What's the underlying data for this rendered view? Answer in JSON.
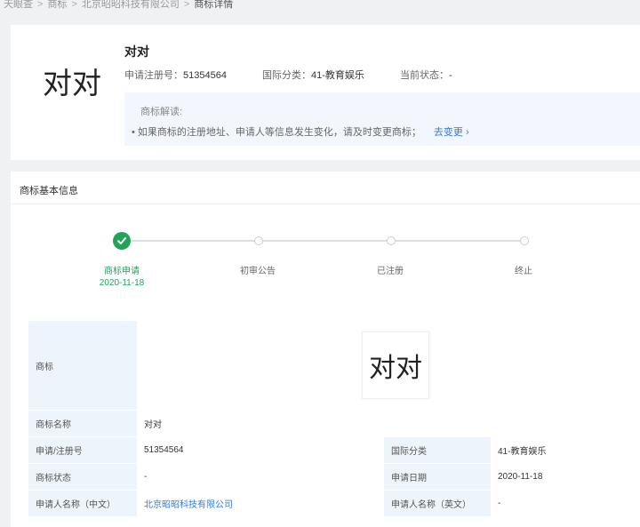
{
  "breadcrumb": {
    "items": [
      "天眼查",
      "商标",
      "北京昭昭科技有限公司",
      "商标详情"
    ],
    "sep": ">"
  },
  "header": {
    "logo_text": "对对",
    "name": "对对",
    "reg_label": "申请注册号：",
    "reg_value": "51354564",
    "class_label": "国际分类：",
    "class_value": "41-教育娱乐",
    "status_label": "当前状态：",
    "status_value": "-"
  },
  "interpretation": {
    "title": "商标解读:",
    "tip": "• 如果商标的注册地址、申请人等信息发生变化，请及时变更商标；",
    "link": "去变更 ›"
  },
  "basic_info": {
    "section_title": "商标基本信息",
    "steps": [
      {
        "label": "商标申请",
        "date": "2020-11-18",
        "done": true
      },
      {
        "label": "初审公告",
        "done": false
      },
      {
        "label": "已注册",
        "done": false
      },
      {
        "label": "终止",
        "done": false
      }
    ],
    "accent_color": "#25a25a",
    "table": {
      "logo_label": "商标",
      "logo_text": "对对",
      "name_label": "商标名称",
      "name_value": "对对",
      "reg_label": "申请/注册号",
      "reg_value": "51354564",
      "class_label": "国际分类",
      "class_value": "41-教育娱乐",
      "status_label": "商标状态",
      "status_value": "-",
      "date_label": "申请日期",
      "date_value": "2020-11-18",
      "applicant_cn_label": "申请人名称（中文）",
      "applicant_cn_value": "北京昭昭科技有限公司",
      "applicant_en_label": "申请人名称（英文）",
      "applicant_en_value": "-"
    }
  }
}
